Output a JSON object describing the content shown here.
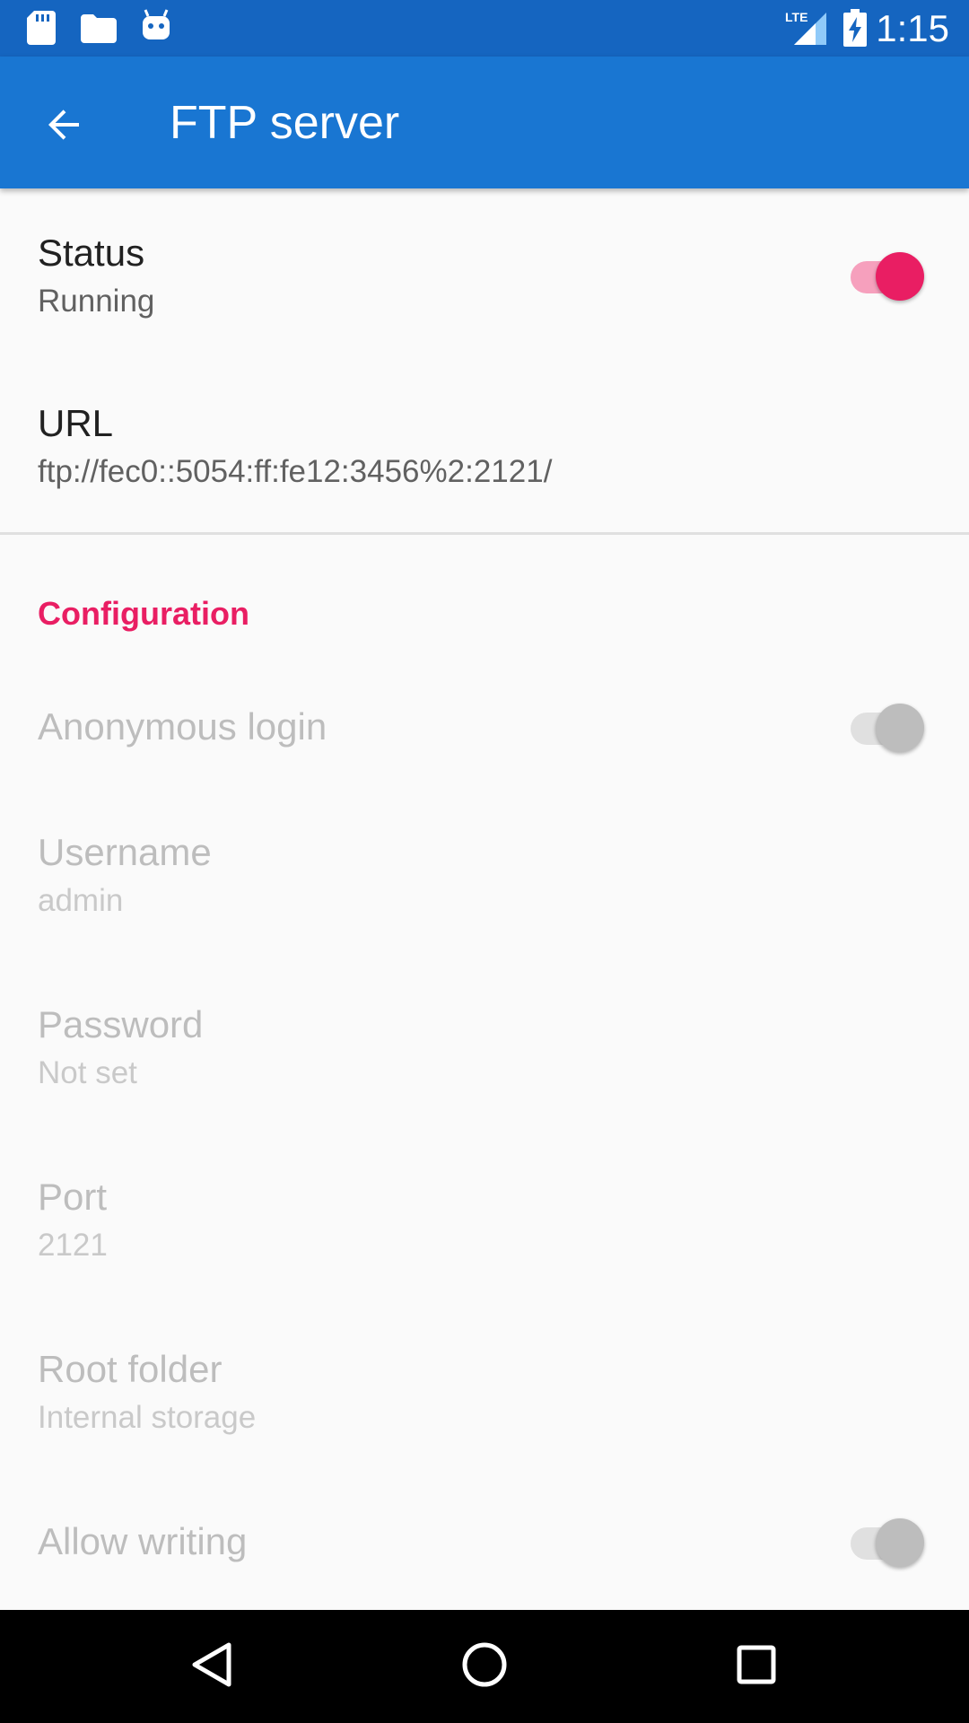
{
  "status_bar": {
    "time": "1:15",
    "icons": [
      "sd-card-icon",
      "folder-icon",
      "android-icon",
      "lte-signal-icon",
      "battery-charging-icon"
    ],
    "network_label": "LTE"
  },
  "app_bar": {
    "title": "FTP server",
    "back_icon": "arrow-back-icon"
  },
  "preferences": {
    "status": {
      "title": "Status",
      "summary": "Running",
      "enabled": true,
      "checked": true
    },
    "url": {
      "title": "URL",
      "summary": "ftp://fec0::5054:ff:fe12:3456%2:2121/"
    },
    "category": "Configuration",
    "anonymous_login": {
      "title": "Anonymous login",
      "enabled": false,
      "checked": true
    },
    "username": {
      "title": "Username",
      "summary": "admin",
      "enabled": false
    },
    "password": {
      "title": "Password",
      "summary": "Not set",
      "enabled": false
    },
    "port": {
      "title": "Port",
      "summary": "2121",
      "enabled": false
    },
    "root_folder": {
      "title": "Root folder",
      "summary": "Internal storage",
      "enabled": false
    },
    "allow_writing": {
      "title": "Allow writing",
      "enabled": false,
      "checked": true
    }
  },
  "colors": {
    "status_bar": "#1565c0",
    "app_bar": "#1976d2",
    "accent": "#e91e63",
    "background": "#fafafa"
  },
  "nav_bar": {
    "icons": [
      "back-triangle-icon",
      "home-circle-icon",
      "recents-square-icon"
    ]
  }
}
